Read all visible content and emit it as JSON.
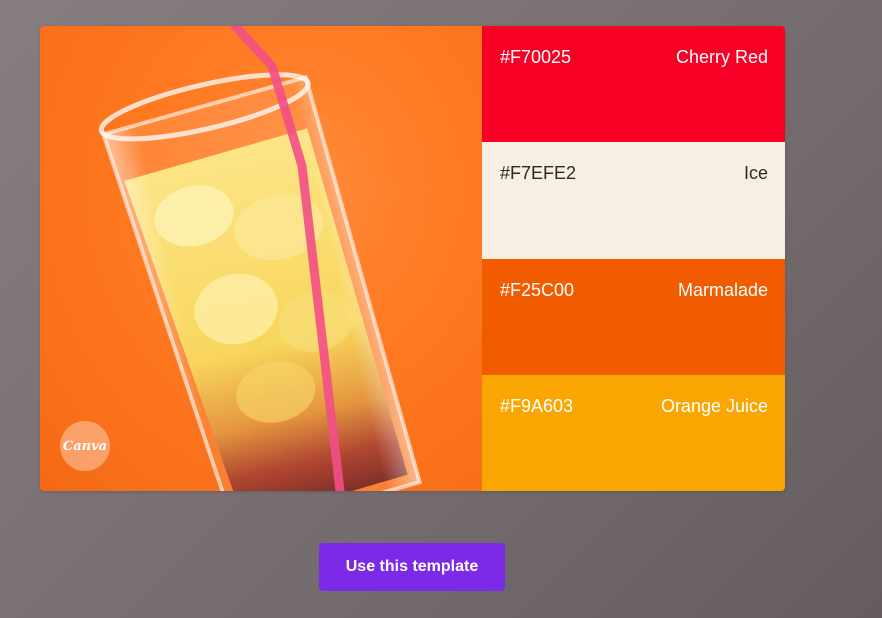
{
  "template": {
    "photo": {
      "alt_icon": "iced-orange-drink-photo",
      "logo_text": "Canva"
    },
    "swatches": [
      {
        "hex": "#F70025",
        "name": "Cherry Red",
        "color": "#F70025",
        "text_color": "#ffffff"
      },
      {
        "hex": "#F7EFE2",
        "name": "Ice",
        "color": "#F7EFE2",
        "text_color": "#2a2a2a"
      },
      {
        "hex": "#F25C00",
        "name": "Marmalade",
        "color": "#F25C00",
        "text_color": "#ffffff"
      },
      {
        "hex": "#F9A603",
        "name": "Orange Juice",
        "color": "#F9A603",
        "text_color": "#ffffff"
      }
    ]
  },
  "actions": {
    "use_template_label": "Use this template",
    "button_color": "#7D2AE8"
  }
}
